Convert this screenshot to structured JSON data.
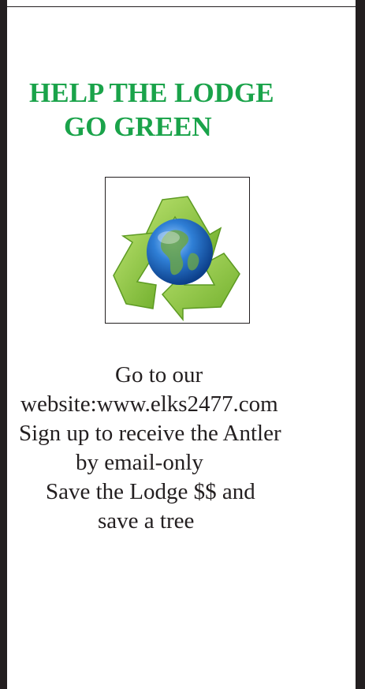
{
  "flyer": {
    "headline_line1": "HELP THE LODGE",
    "headline_line2": "GO GREEN",
    "image": {
      "icon": "recycle-globe-icon",
      "colors": {
        "arrows": "#8cc63f",
        "globe": "#1f5fb5",
        "land": "#6aa54a"
      }
    },
    "body_lines": [
      "Go to our",
      "website:www.elks2477.com",
      "Sign up to receive the Antler",
      "by  email-only",
      "Save the Lodge $$ and",
      "save a tree"
    ],
    "colors": {
      "headline": "#1aa34a",
      "text": "#231f20",
      "border": "#231f20"
    }
  }
}
